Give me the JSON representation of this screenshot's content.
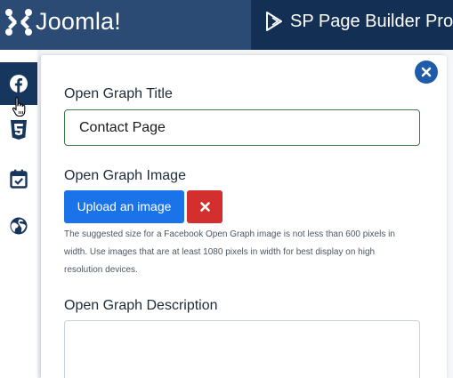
{
  "header": {
    "brand_name": "Joomla!",
    "page_title": "SP Page Builder Pro -",
    "colors": {
      "bar": "#132f53",
      "brand": "#2b4a74"
    }
  },
  "left_rail": {
    "items": [
      {
        "icon": "facebook-icon",
        "active": true
      },
      {
        "icon": "css3-icon",
        "active": false
      },
      {
        "icon": "calendar-check-icon",
        "active": false
      },
      {
        "icon": "globe-icon",
        "active": false
      }
    ]
  },
  "modal": {
    "close_icon": "close-icon",
    "og_title": {
      "label": "Open Graph Title",
      "value": "Contact Page"
    },
    "og_image": {
      "label": "Open Graph Image",
      "upload_label": "Upload an image",
      "remove_icon": "x-icon",
      "help": "The suggested size for a Facebook Open Graph image is not less than 600 pixels in width. Use images that are at least 1080 pixels in width for best display on high resolution devices."
    },
    "og_description": {
      "label": "Open Graph Description",
      "value": ""
    },
    "colors": {
      "primary": "#1a73e8",
      "danger": "#d32f2f",
      "input_border": "#3d7a47"
    }
  }
}
